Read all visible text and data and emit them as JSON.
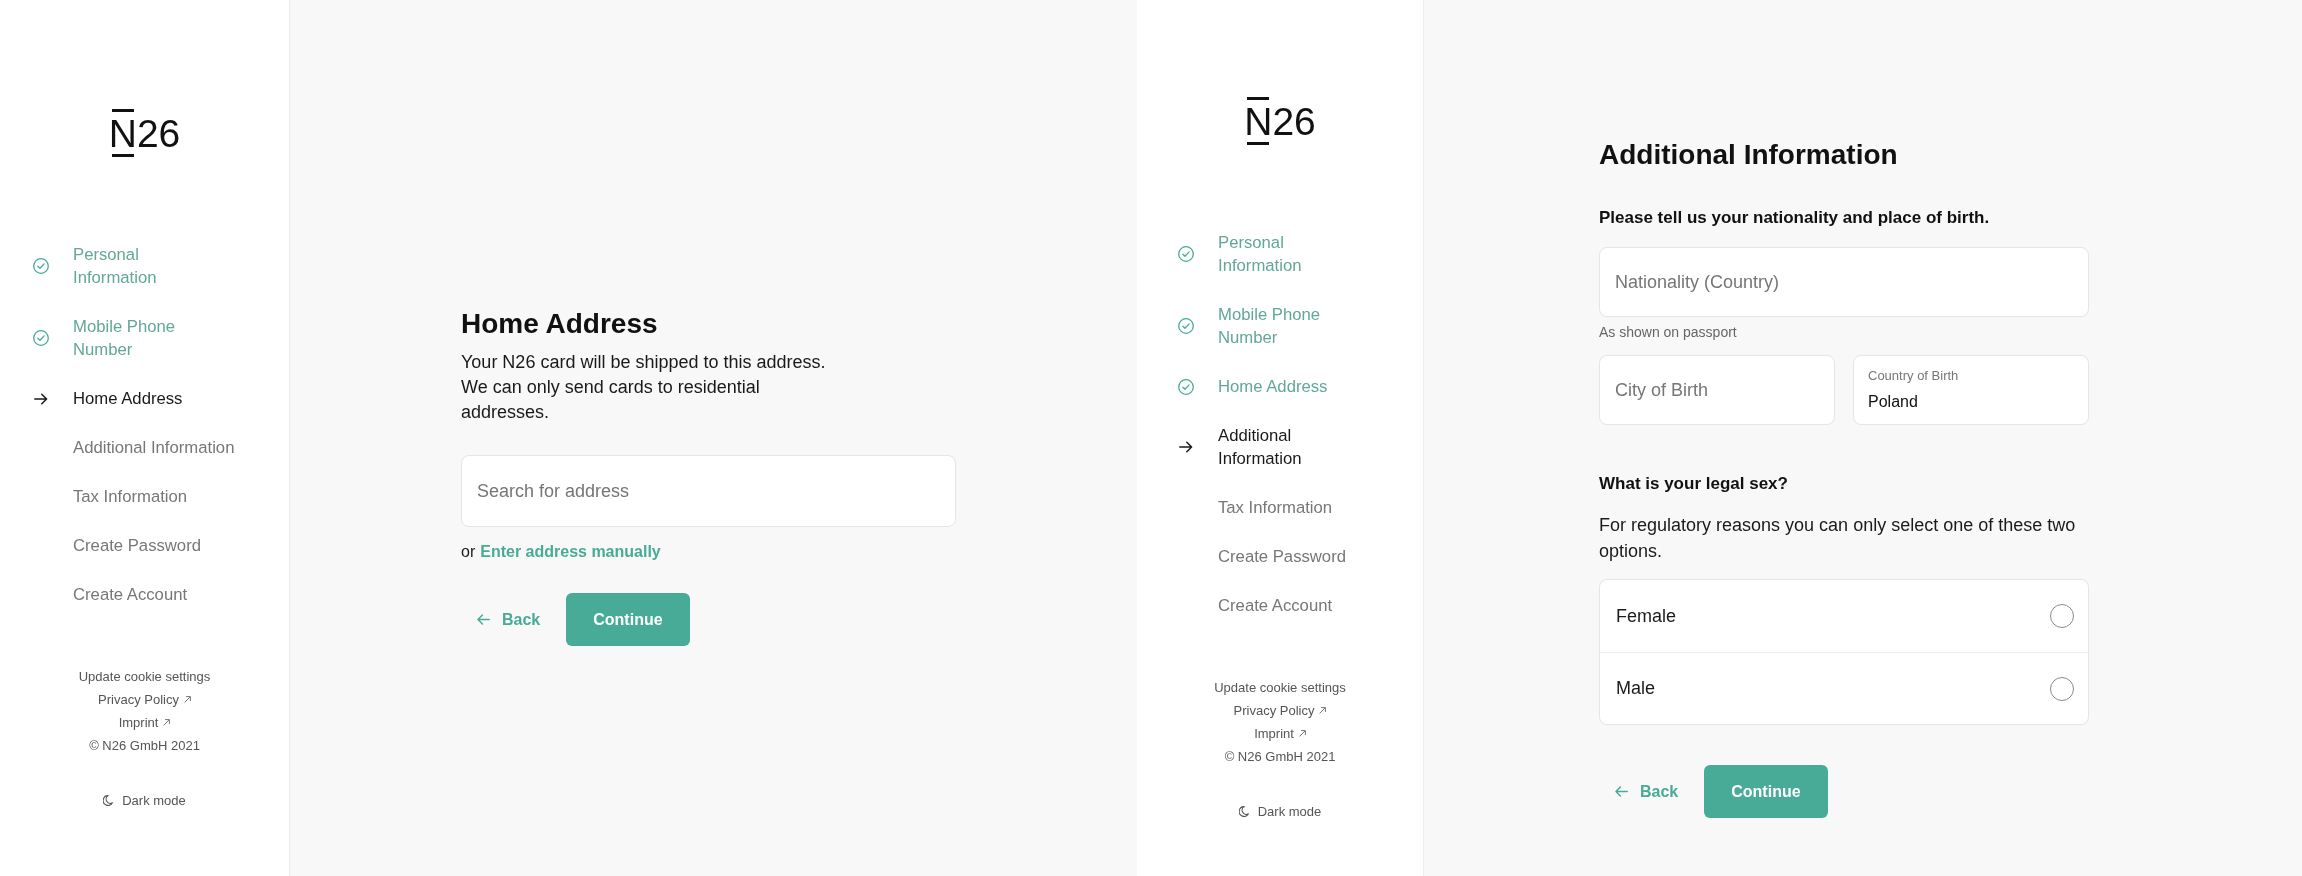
{
  "screens": [
    {
      "logo": "N26",
      "steps": [
        {
          "label": "Personal Information",
          "completed": true,
          "current": false
        },
        {
          "label": "Mobile Phone Number",
          "completed": true,
          "current": false
        },
        {
          "label": "Home Address",
          "completed": false,
          "current": true
        },
        {
          "label": "Additional Information",
          "completed": false,
          "current": false
        },
        {
          "label": "Tax Information",
          "completed": false,
          "current": false
        },
        {
          "label": "Create Password",
          "completed": false,
          "current": false
        },
        {
          "label": "Create Account",
          "completed": false,
          "current": false
        }
      ],
      "footer": {
        "links": [
          {
            "label": "Update cookie settings",
            "external": false
          },
          {
            "label": "Privacy Policy",
            "external": true
          },
          {
            "label": "Imprint",
            "external": true
          }
        ],
        "copyright": "© N26 GmbH 2021",
        "dark_mode": "Dark mode"
      },
      "form": {
        "kind": "address",
        "title": "Home Address",
        "description": "Your N26 card will be shipped to this address. We can only send cards to residential addresses.",
        "search_field": {
          "placeholder": "Search for address"
        },
        "manual_entry": {
          "prefix": "or",
          "link": "Enter address manually"
        },
        "back_button": "Back",
        "continue_button": "Continue"
      }
    },
    {
      "logo": "N26",
      "steps": [
        {
          "label": "Personal Information",
          "completed": true,
          "current": false
        },
        {
          "label": "Mobile Phone Number",
          "completed": true,
          "current": false
        },
        {
          "label": "Home Address",
          "completed": true,
          "current": false
        },
        {
          "label": "Additional Information",
          "completed": false,
          "current": true
        },
        {
          "label": "Tax Information",
          "completed": false,
          "current": false
        },
        {
          "label": "Create Password",
          "completed": false,
          "current": false
        },
        {
          "label": "Create Account",
          "completed": false,
          "current": false
        }
      ],
      "footer": {
        "links": [
          {
            "label": "Update cookie settings",
            "external": false
          },
          {
            "label": "Privacy Policy",
            "external": true
          },
          {
            "label": "Imprint",
            "external": true
          }
        ],
        "copyright": "© N26 GmbH 2021",
        "dark_mode": "Dark mode"
      },
      "form": {
        "kind": "details",
        "title": "Additional Information",
        "origin_section": {
          "heading": "Please tell us your nationality and place of birth.",
          "nationality_field": {
            "placeholder": "Nationality (Country)",
            "hint": "As shown on passport"
          },
          "city_field": {
            "placeholder": "City of Birth"
          },
          "country_field": {
            "label": "Country of Birth",
            "value": "Poland"
          }
        },
        "sex_section": {
          "heading": "What is your legal sex?",
          "description": "For regulatory reasons you can only select one of these two options.",
          "options": [
            {
              "label": "Female",
              "selected": false
            },
            {
              "label": "Male",
              "selected": false
            }
          ]
        },
        "back_button": "Back",
        "continue_button": "Continue"
      }
    }
  ]
}
